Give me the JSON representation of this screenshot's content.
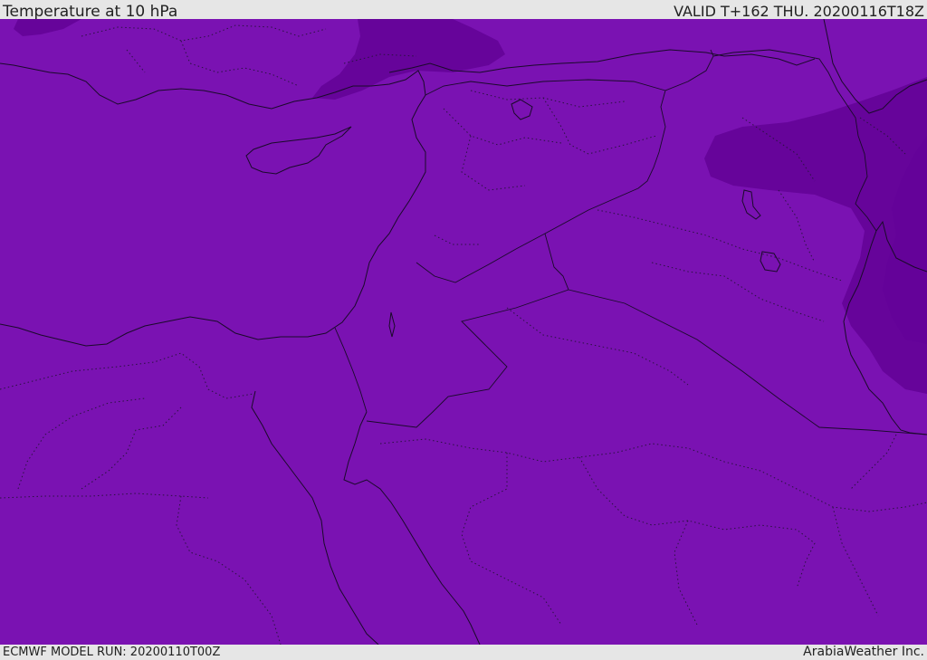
{
  "header": {
    "title": "Temperature at 10 hPa",
    "valid": "VALID T+162 THU. 20200116T18Z"
  },
  "footer": {
    "model_run": "ECMWF MODEL RUN: 20200110T00Z",
    "credit": "ArabiaWeather Inc."
  },
  "map": {
    "fill_color": "#7a12b2",
    "cold_fill_color": "#66049a"
  }
}
